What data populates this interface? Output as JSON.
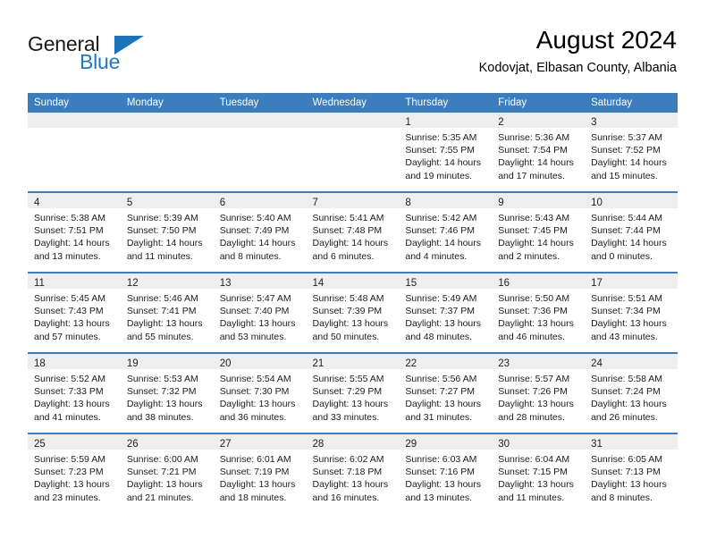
{
  "brand": {
    "name_part1": "General",
    "name_part2": "Blue",
    "logo_icon": "triangle-flag-icon",
    "accent_color": "#1c78c0"
  },
  "header": {
    "month_title": "August 2024",
    "location": "Kodovjat, Elbasan County, Albania"
  },
  "colors": {
    "header_row": "#3b7dbd",
    "daynum_band": "#eeeeee",
    "row_divider": "#3b7dbd",
    "text": "#1c1c1c"
  },
  "weekday_headers": [
    "Sunday",
    "Monday",
    "Tuesday",
    "Wednesday",
    "Thursday",
    "Friday",
    "Saturday"
  ],
  "weeks": [
    [
      {
        "day": "",
        "lines": []
      },
      {
        "day": "",
        "lines": []
      },
      {
        "day": "",
        "lines": []
      },
      {
        "day": "",
        "lines": []
      },
      {
        "day": "1",
        "lines": [
          "Sunrise: 5:35 AM",
          "Sunset: 7:55 PM",
          "Daylight: 14 hours",
          "and 19 minutes."
        ]
      },
      {
        "day": "2",
        "lines": [
          "Sunrise: 5:36 AM",
          "Sunset: 7:54 PM",
          "Daylight: 14 hours",
          "and 17 minutes."
        ]
      },
      {
        "day": "3",
        "lines": [
          "Sunrise: 5:37 AM",
          "Sunset: 7:52 PM",
          "Daylight: 14 hours",
          "and 15 minutes."
        ]
      }
    ],
    [
      {
        "day": "4",
        "lines": [
          "Sunrise: 5:38 AM",
          "Sunset: 7:51 PM",
          "Daylight: 14 hours",
          "and 13 minutes."
        ]
      },
      {
        "day": "5",
        "lines": [
          "Sunrise: 5:39 AM",
          "Sunset: 7:50 PM",
          "Daylight: 14 hours",
          "and 11 minutes."
        ]
      },
      {
        "day": "6",
        "lines": [
          "Sunrise: 5:40 AM",
          "Sunset: 7:49 PM",
          "Daylight: 14 hours",
          "and 8 minutes."
        ]
      },
      {
        "day": "7",
        "lines": [
          "Sunrise: 5:41 AM",
          "Sunset: 7:48 PM",
          "Daylight: 14 hours",
          "and 6 minutes."
        ]
      },
      {
        "day": "8",
        "lines": [
          "Sunrise: 5:42 AM",
          "Sunset: 7:46 PM",
          "Daylight: 14 hours",
          "and 4 minutes."
        ]
      },
      {
        "day": "9",
        "lines": [
          "Sunrise: 5:43 AM",
          "Sunset: 7:45 PM",
          "Daylight: 14 hours",
          "and 2 minutes."
        ]
      },
      {
        "day": "10",
        "lines": [
          "Sunrise: 5:44 AM",
          "Sunset: 7:44 PM",
          "Daylight: 14 hours",
          "and 0 minutes."
        ]
      }
    ],
    [
      {
        "day": "11",
        "lines": [
          "Sunrise: 5:45 AM",
          "Sunset: 7:43 PM",
          "Daylight: 13 hours",
          "and 57 minutes."
        ]
      },
      {
        "day": "12",
        "lines": [
          "Sunrise: 5:46 AM",
          "Sunset: 7:41 PM",
          "Daylight: 13 hours",
          "and 55 minutes."
        ]
      },
      {
        "day": "13",
        "lines": [
          "Sunrise: 5:47 AM",
          "Sunset: 7:40 PM",
          "Daylight: 13 hours",
          "and 53 minutes."
        ]
      },
      {
        "day": "14",
        "lines": [
          "Sunrise: 5:48 AM",
          "Sunset: 7:39 PM",
          "Daylight: 13 hours",
          "and 50 minutes."
        ]
      },
      {
        "day": "15",
        "lines": [
          "Sunrise: 5:49 AM",
          "Sunset: 7:37 PM",
          "Daylight: 13 hours",
          "and 48 minutes."
        ]
      },
      {
        "day": "16",
        "lines": [
          "Sunrise: 5:50 AM",
          "Sunset: 7:36 PM",
          "Daylight: 13 hours",
          "and 46 minutes."
        ]
      },
      {
        "day": "17",
        "lines": [
          "Sunrise: 5:51 AM",
          "Sunset: 7:34 PM",
          "Daylight: 13 hours",
          "and 43 minutes."
        ]
      }
    ],
    [
      {
        "day": "18",
        "lines": [
          "Sunrise: 5:52 AM",
          "Sunset: 7:33 PM",
          "Daylight: 13 hours",
          "and 41 minutes."
        ]
      },
      {
        "day": "19",
        "lines": [
          "Sunrise: 5:53 AM",
          "Sunset: 7:32 PM",
          "Daylight: 13 hours",
          "and 38 minutes."
        ]
      },
      {
        "day": "20",
        "lines": [
          "Sunrise: 5:54 AM",
          "Sunset: 7:30 PM",
          "Daylight: 13 hours",
          "and 36 minutes."
        ]
      },
      {
        "day": "21",
        "lines": [
          "Sunrise: 5:55 AM",
          "Sunset: 7:29 PM",
          "Daylight: 13 hours",
          "and 33 minutes."
        ]
      },
      {
        "day": "22",
        "lines": [
          "Sunrise: 5:56 AM",
          "Sunset: 7:27 PM",
          "Daylight: 13 hours",
          "and 31 minutes."
        ]
      },
      {
        "day": "23",
        "lines": [
          "Sunrise: 5:57 AM",
          "Sunset: 7:26 PM",
          "Daylight: 13 hours",
          "and 28 minutes."
        ]
      },
      {
        "day": "24",
        "lines": [
          "Sunrise: 5:58 AM",
          "Sunset: 7:24 PM",
          "Daylight: 13 hours",
          "and 26 minutes."
        ]
      }
    ],
    [
      {
        "day": "25",
        "lines": [
          "Sunrise: 5:59 AM",
          "Sunset: 7:23 PM",
          "Daylight: 13 hours",
          "and 23 minutes."
        ]
      },
      {
        "day": "26",
        "lines": [
          "Sunrise: 6:00 AM",
          "Sunset: 7:21 PM",
          "Daylight: 13 hours",
          "and 21 minutes."
        ]
      },
      {
        "day": "27",
        "lines": [
          "Sunrise: 6:01 AM",
          "Sunset: 7:19 PM",
          "Daylight: 13 hours",
          "and 18 minutes."
        ]
      },
      {
        "day": "28",
        "lines": [
          "Sunrise: 6:02 AM",
          "Sunset: 7:18 PM",
          "Daylight: 13 hours",
          "and 16 minutes."
        ]
      },
      {
        "day": "29",
        "lines": [
          "Sunrise: 6:03 AM",
          "Sunset: 7:16 PM",
          "Daylight: 13 hours",
          "and 13 minutes."
        ]
      },
      {
        "day": "30",
        "lines": [
          "Sunrise: 6:04 AM",
          "Sunset: 7:15 PM",
          "Daylight: 13 hours",
          "and 11 minutes."
        ]
      },
      {
        "day": "31",
        "lines": [
          "Sunrise: 6:05 AM",
          "Sunset: 7:13 PM",
          "Daylight: 13 hours",
          "and 8 minutes."
        ]
      }
    ]
  ]
}
